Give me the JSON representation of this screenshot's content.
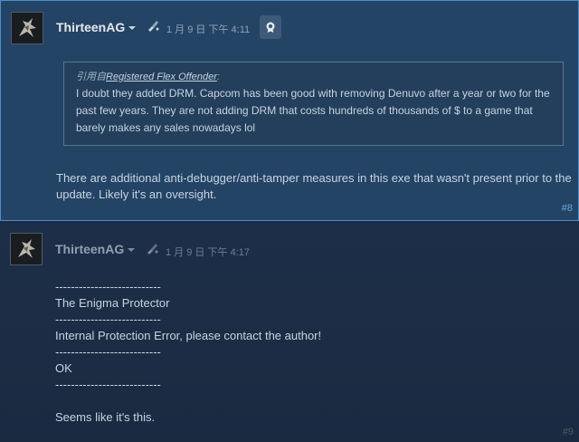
{
  "posts": [
    {
      "author": "ThirteenAG",
      "timestamp": "1 月 9 日 下午 4:11",
      "quote": {
        "prefix": "引用自",
        "source": "Registered Flex Offender",
        "suffix": ":",
        "text": "I doubt they added DRM. Capcom has been good with removing Denuvo after a year or two for the past few years. They are not adding DRM that costs hundreds of thousands of $ to a game that barely makes any sales nowadays lol"
      },
      "body": "There are additional anti-debugger/anti-tamper measures in this exe that wasn't present prior to the update. Likely it's an oversight.",
      "number": "#8"
    },
    {
      "author": "ThirteenAG",
      "timestamp": "1 月 9 日 下午 4:17",
      "lines": [
        "---------------------------",
        "The Enigma Protector",
        "---------------------------",
        "Internal Protection Error, please contact the author!",
        "---------------------------",
        "OK",
        "---------------------------",
        "",
        "Seems like it's this."
      ],
      "number": "#9"
    }
  ],
  "colors": {
    "highlight_bg": "#244466",
    "highlight_border": "#4a8fc9",
    "page_bg": "#1b2a3f"
  },
  "icons": {
    "author_menu": "chevron-down-icon",
    "badge": "paintbrush-badge-icon",
    "award": "award-icon"
  }
}
